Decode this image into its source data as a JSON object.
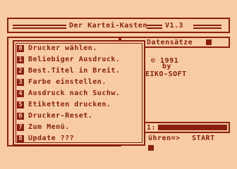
{
  "header": {
    "title": "Der Kartei-Kasten",
    "version": "V1.3"
  },
  "info_panel": {
    "label": "Datensätze",
    "copyright": "© 1991",
    "by": "by",
    "company": "EIKO-SOFT"
  },
  "bottom": {
    "field_label": "1:",
    "hint": "ühren=>",
    "start_label": "START"
  },
  "menu": {
    "items": [
      {
        "key": "0",
        "label": "Drucker wählen."
      },
      {
        "key": "1",
        "label": "Beliebiger Ausdruck."
      },
      {
        "key": "2",
        "label": "Best.Titel in Breit."
      },
      {
        "key": "3",
        "label": "Farbe einstellen."
      },
      {
        "key": "4",
        "label": "Ausdruck nach Suchw."
      },
      {
        "key": "5",
        "label": "Etiketten drucken."
      },
      {
        "key": "6",
        "label": "Drucker-Reset."
      },
      {
        "key": "7",
        "label": "Zum Menü."
      },
      {
        "key": "8",
        "label": "Update ???"
      }
    ]
  },
  "colors": {
    "background": "#f7cca5",
    "foreground": "#8a1e10"
  }
}
